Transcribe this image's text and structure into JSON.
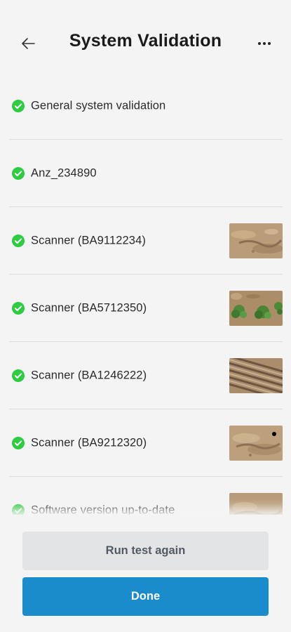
{
  "header": {
    "title": "System Validation",
    "back_icon": "arrow-left-icon",
    "menu_icon": "more-horizontal-icon"
  },
  "status_color": "#2ecc40",
  "accent_color": "#1a8ccc",
  "items": [
    {
      "label": "General system validation",
      "status": "passed",
      "thumbnail": null
    },
    {
      "label": "Anz_234890",
      "status": "passed",
      "thumbnail": null
    },
    {
      "label": "Scanner (BA9112234)",
      "status": "passed",
      "thumbnail": "bare-soil"
    },
    {
      "label": "Scanner (BA5712350)",
      "status": "passed",
      "thumbnail": "soil-with-plants"
    },
    {
      "label": "Scanner (BA1246222)",
      "status": "passed",
      "thumbnail": "tilled-rows"
    },
    {
      "label": "Scanner (BA9212320)",
      "status": "passed",
      "thumbnail": "bare-soil"
    },
    {
      "label": "Software version up-to-date",
      "status": "passed",
      "thumbnail": "bare-soil"
    }
  ],
  "actions": {
    "secondary_label": "Run test again",
    "primary_label": "Done"
  }
}
